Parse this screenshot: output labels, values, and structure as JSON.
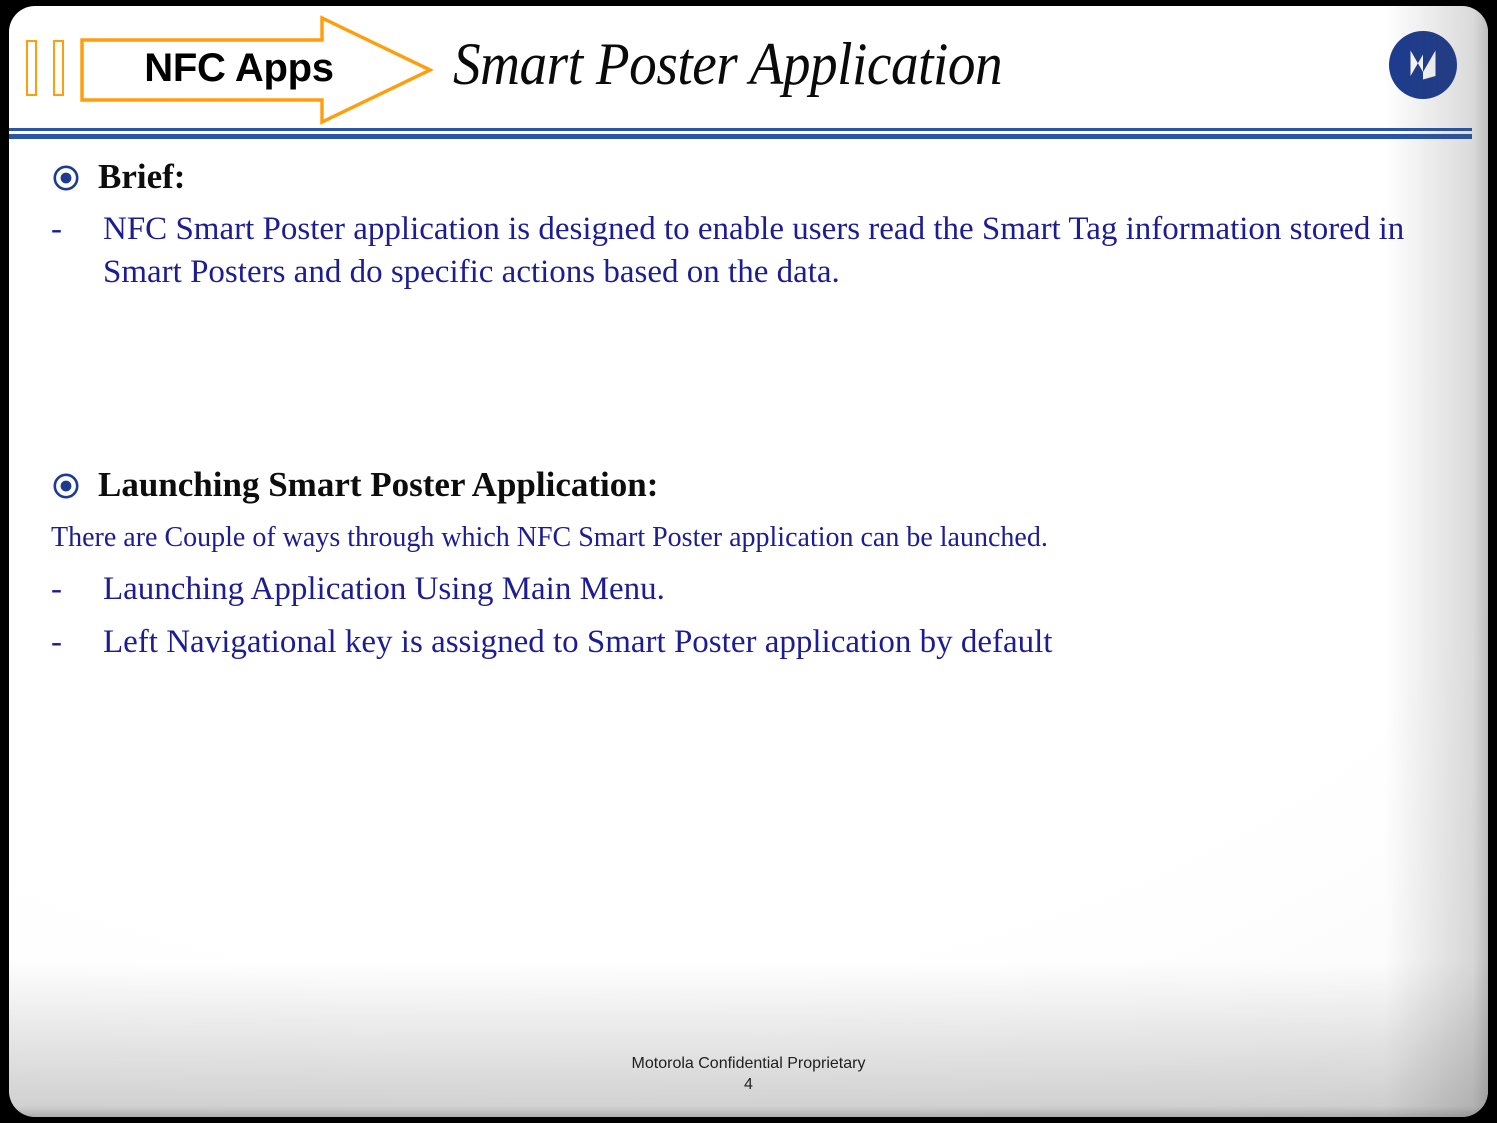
{
  "slide": {
    "section_tag": "NFC Apps",
    "title": "Smart Poster Application",
    "logo_name": "motorola-logo"
  },
  "sections": [
    {
      "heading": "Brief:",
      "bullets": [
        {
          "marker": "-",
          "text": "NFC Smart Poster application is designed to enable users read the Smart Tag information stored in Smart Posters and do specific actions based on the data."
        }
      ]
    },
    {
      "heading": "Launching Smart Poster Application:",
      "intro": "There are Couple of ways through which NFC Smart Poster application can be launched.",
      "bullets": [
        {
          "marker": "-",
          "text": "Launching Application Using Main Menu."
        },
        {
          "marker": "-",
          "text": "Left Navigational key is assigned to Smart Poster application by default"
        }
      ]
    }
  ],
  "footer": {
    "confidentiality": "Motorola Confidential Proprietary",
    "page_number": "4"
  },
  "colors": {
    "accent_orange": "#FF9D0B",
    "rule_blue": "#2A55A8",
    "body_blue": "#1D1D93",
    "logo_blue": "#1D3C8F",
    "heading_black": "#0d0d0d"
  }
}
